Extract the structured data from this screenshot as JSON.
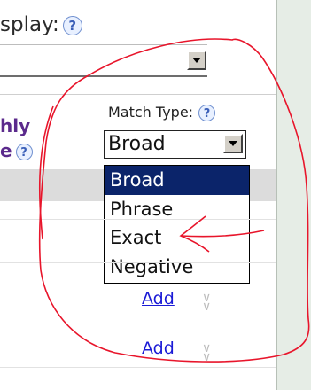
{
  "display": {
    "label": "splay:"
  },
  "column": {
    "line1": "hly",
    "line2": "e"
  },
  "match_type": {
    "label": "Match Type:",
    "selected": "Broad",
    "options": [
      "Broad",
      "Phrase",
      "Exact",
      "Negative"
    ]
  },
  "rows": [
    {
      "link": "Add"
    },
    {
      "link": "Add"
    }
  ],
  "colors": {
    "selection": "#0b246a",
    "heading": "#5b2a8c",
    "link": "#1a1ad6",
    "annotation": "#e8152b"
  }
}
